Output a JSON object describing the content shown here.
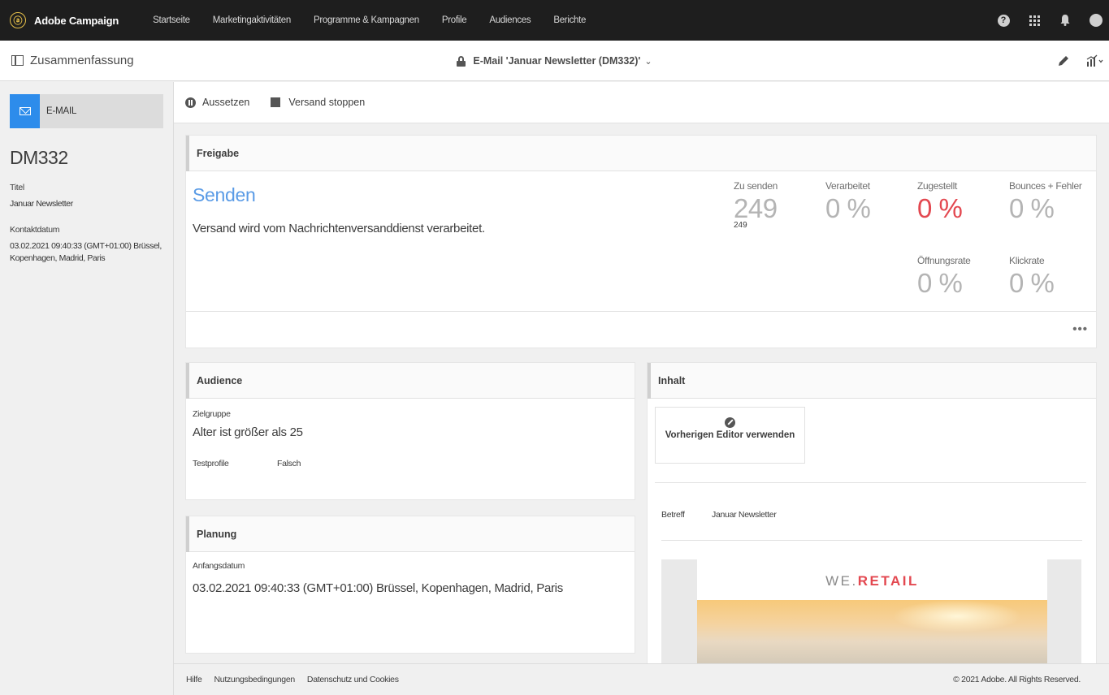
{
  "app": {
    "brand": "Adobe Campaign",
    "brand_color": "#e8c14a"
  },
  "nav": {
    "items": [
      {
        "label": "Startseite"
      },
      {
        "label": "Marketingaktivitäten"
      },
      {
        "label": "Programme & Kampagnen"
      },
      {
        "label": "Profile"
      },
      {
        "label": "Audiences"
      },
      {
        "label": "Berichte"
      }
    ],
    "help_glyph": "?",
    "icons": [
      "help-icon",
      "apps-icon",
      "bell-icon",
      "avatar"
    ]
  },
  "subheader": {
    "summary_label": "Zusammenfassung",
    "title": "E-Mail 'Januar Newsletter (DM332)'",
    "chevron": "⌄"
  },
  "sidebar": {
    "channel_label": "E-MAIL",
    "channel_color": "#2d8ceb",
    "code": "DM332",
    "fields": [
      {
        "label": "Titel",
        "value": "Januar Newsletter"
      },
      {
        "label": "Kontaktdatum",
        "value": "03.02.2021 09:40:33 (GMT+01:00) Brüssel, Kopenhagen, Madrid, Paris"
      }
    ]
  },
  "toolbar": {
    "pause_label": "Aussetzen",
    "stop_label": "Versand stoppen"
  },
  "freigabe": {
    "title": "Freigabe",
    "status": "Senden",
    "status_color": "#5a9be6",
    "message": "Versand wird vom Nachrichtenversanddienst verarbeitet.",
    "kpis": [
      {
        "label": "Zu senden",
        "value": "249",
        "sub": "249"
      },
      {
        "label": "Verarbeitet",
        "value": "0 %"
      },
      {
        "label": "Zugestellt",
        "value": "0 %",
        "color": "#e34850"
      },
      {
        "label": "Bounces + Fehler",
        "value": "0 %"
      },
      {
        "label": "Öffnungsrate",
        "value": "0 %"
      },
      {
        "label": "Klickrate",
        "value": "0 %"
      }
    ],
    "more": "•••"
  },
  "audience": {
    "title": "Audience",
    "target_label": "Zielgruppe",
    "target_value": "Alter ist größer als 25",
    "test_label": "Testprofile",
    "test_value": "Falsch"
  },
  "planung": {
    "title": "Planung",
    "start_label": "Anfangsdatum",
    "start_value": "03.02.2021 09:40:33 (GMT+01:00) Brüssel, Kopenhagen, Madrid, Paris"
  },
  "inhalt": {
    "title": "Inhalt",
    "editor_button": "Vorherigen Editor verwenden",
    "subject_label": "Betreff",
    "subject_value": "Januar Newsletter",
    "logo_prefix": "WE.",
    "logo_suffix": "RETAIL"
  },
  "footer": {
    "links": [
      "Hilfe",
      "Nutzungsbedingungen",
      "Datenschutz und Cookies"
    ],
    "copyright": "© 2021 Adobe. All Rights Reserved."
  }
}
